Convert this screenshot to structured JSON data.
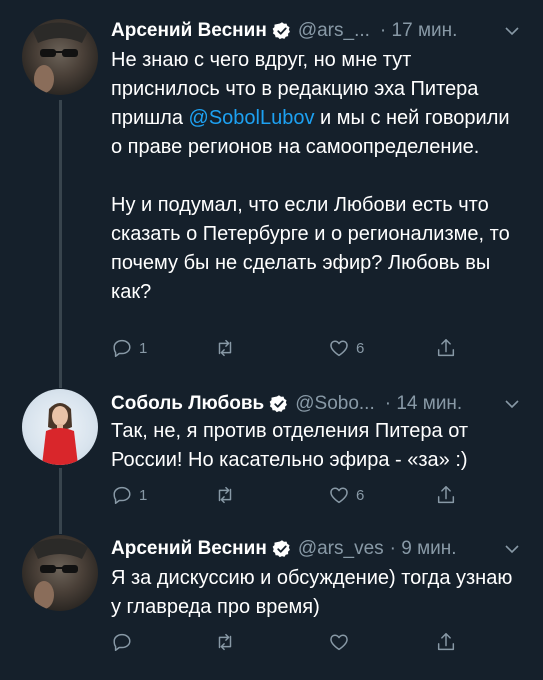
{
  "tweets": [
    {
      "name": "Арсений Веснин",
      "handle": "@ars_...",
      "time": "· 17 мин.",
      "text_a": "Не знаю с чего вдруг, но мне тут приснилось что в редакцию эха Питера пришла ",
      "mention": "@SobolLubov",
      "text_b": " и мы с ней говорили о праве регионов на самоопределение.\n\nНу и подумал, что если Любови есть что сказать о Петербурге и о регионализме, то почему бы не сделать эфир? Любовь вы как?",
      "replies": "1",
      "retweets": "",
      "likes": "6"
    },
    {
      "name": "Соболь Любовь",
      "handle": "@Sobo...",
      "time": "· 14 мин.",
      "text": "Так, не, я против отделения Питера от России! Но касательно эфира - «за» :)",
      "replies": "1",
      "retweets": "",
      "likes": "6"
    },
    {
      "name": "Арсений Веснин",
      "handle": "@ars_ves",
      "time": "· 9 мин.",
      "text": "Я за дискуссию и обсуждение) тогда узнаю у главреда про время)",
      "replies": "",
      "retweets": "",
      "likes": ""
    }
  ],
  "colors": {
    "background": "#15202b",
    "secondary_text": "#8899a6",
    "link": "#1da1f2",
    "verified": "#ffffff"
  }
}
